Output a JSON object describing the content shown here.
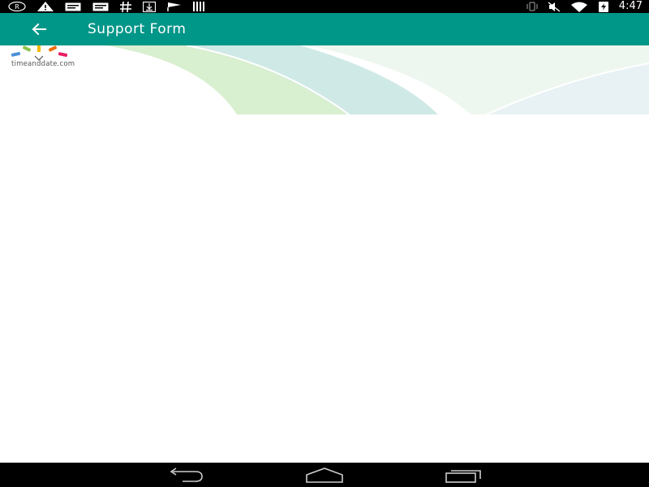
{
  "status_bar": {
    "time": "4:47",
    "left_icons": [
      "registered-icon",
      "warning-icon",
      "message-icon",
      "message-icon",
      "hash-icon",
      "download-icon",
      "check-flag-icon",
      "barcode-icon"
    ],
    "right_icons": [
      "vibrate-icon",
      "mute-icon",
      "wifi-icon",
      "battery-charging-icon"
    ]
  },
  "app_bar": {
    "title": "Support Form",
    "color": "#009688"
  },
  "header": {
    "logo_text": "timeanddate.com"
  },
  "nav_bar": {
    "buttons": [
      "back",
      "home",
      "recents"
    ]
  }
}
